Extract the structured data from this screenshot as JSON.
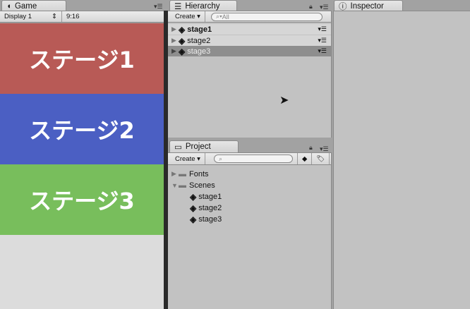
{
  "game": {
    "tab": "Game",
    "display": "Display 1",
    "aspect": "9:16",
    "stages": [
      {
        "label": "ステージ1",
        "color": "#b85a56"
      },
      {
        "label": "ステージ2",
        "color": "#4b5fc3"
      },
      {
        "label": "ステージ3",
        "color": "#78be5c"
      }
    ]
  },
  "hierarchy": {
    "tab": "Hierarchy",
    "create": "Create",
    "search_placeholder": "All",
    "items": [
      {
        "label": "stage1",
        "bold": true
      },
      {
        "label": "stage2"
      },
      {
        "label": "stage3",
        "selected": true
      }
    ]
  },
  "project": {
    "tab": "Project",
    "create": "Create",
    "folders": [
      {
        "label": "Fonts",
        "expanded": false
      },
      {
        "label": "Scenes",
        "expanded": true,
        "children": [
          "stage1",
          "stage2",
          "stage3"
        ]
      }
    ]
  },
  "inspector": {
    "tab": "Inspector"
  }
}
